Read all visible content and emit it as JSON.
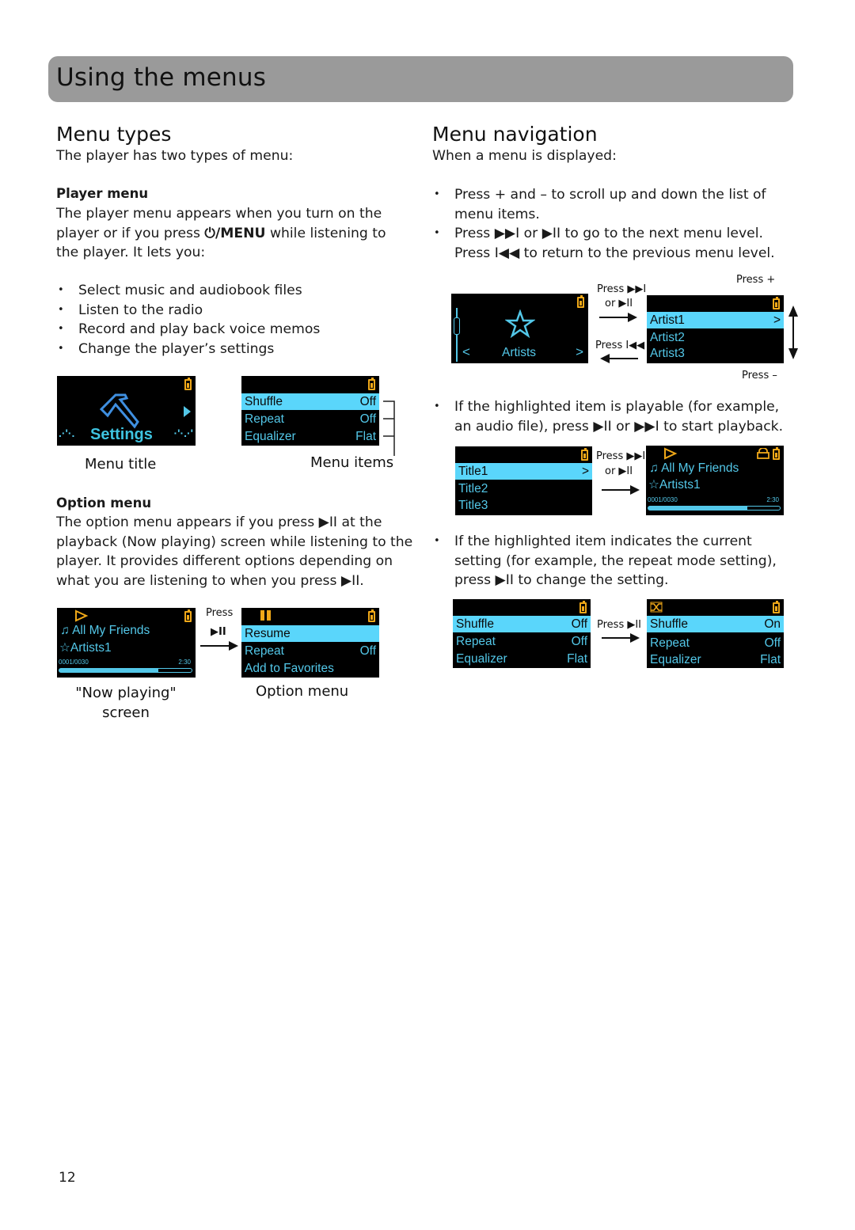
{
  "page": {
    "title": "Using the menus",
    "page_number": "12"
  },
  "menu_types": {
    "heading": "Menu types",
    "intro": "The player has two types of menu:",
    "player_menu": {
      "heading": "Player menu",
      "text_before": "The player menu appears when you turn on the player or if you press ",
      "button": "⏻/MENU",
      "text_after": " while listening to the player. It lets you:",
      "bullets": [
        "Select music and audiobook files",
        "Listen to the radio",
        "Record and play back voice memos",
        "Change the player’s settings"
      ],
      "screen_title": {
        "label": "Settings",
        "caption": "Menu title"
      },
      "screen_items": {
        "rows": [
          {
            "label": "Shuffle",
            "value": "Off",
            "selected": true
          },
          {
            "label": "Repeat",
            "value": "Off",
            "selected": false
          },
          {
            "label": "Equalizer",
            "value": "Flat",
            "selected": false
          }
        ],
        "caption": "Menu items"
      }
    },
    "option_menu": {
      "heading": "Option menu",
      "text": "The option menu appears if you press ▶II at the playback (Now playing) screen while listening to the player. It provides different options depending on what you are listening to when you press ▶II.",
      "now_playing": {
        "song": "All My Friends",
        "artist": "Artists1",
        "track": "0001/0030",
        "time": "2:30",
        "progress": 0.75,
        "caption_line1": "\"Now playing\"",
        "caption_line2": "screen"
      },
      "press_label": "Press",
      "press_button": "▶II",
      "option_screen": {
        "rows": [
          {
            "label": "Resume",
            "value": "",
            "selected": true
          },
          {
            "label": "Repeat",
            "value": "Off",
            "selected": false
          },
          {
            "label": "Add to Favorites",
            "value": "",
            "selected": false
          }
        ],
        "caption": "Option menu"
      }
    }
  },
  "menu_navigation": {
    "heading": "Menu navigation",
    "intro": "When a menu is displayed:",
    "bullets": [
      "Press + and – to scroll up and down the list of menu items.",
      "Press ▶▶I or ▶II to go to the next menu level. Press I◀◀ to return to the previous menu level."
    ],
    "diagram1": {
      "category_label": "Artists",
      "press_next_line1": "Press ▶▶I",
      "press_next_line2": "or ▶II",
      "press_back": "Press I◀◀",
      "press_plus": "Press +",
      "press_minus": "Press –",
      "rows": [
        {
          "label": "Artist1",
          "selected": true
        },
        {
          "label": "Artist2",
          "selected": false
        },
        {
          "label": "Artist3",
          "selected": false
        }
      ]
    },
    "bullet_playable": "If the highlighted item is playable (for example, an audio file), press ▶II or ▶▶I to start playback.",
    "diagram2": {
      "rows": [
        {
          "label": "Title1",
          "selected": true
        },
        {
          "label": "Title2",
          "selected": false
        },
        {
          "label": "Title3",
          "selected": false
        }
      ],
      "press_line1": "Press ▶▶I",
      "press_line2": "or ▶II",
      "now_playing": {
        "song": "All My Friends",
        "artist": "Artists1",
        "track": "0001/0030",
        "time": "2:30",
        "progress": 0.75
      }
    },
    "bullet_setting": "If the highlighted item indicates the current setting (for example, the repeat mode setting), press ▶II to change the setting.",
    "diagram3": {
      "before": [
        {
          "label": "Shuffle",
          "value": "Off",
          "selected": true
        },
        {
          "label": "Repeat",
          "value": "Off",
          "selected": false
        },
        {
          "label": "Equalizer",
          "value": "Flat",
          "selected": false
        }
      ],
      "press": "Press ▶II",
      "after": [
        {
          "label": "Shuffle",
          "value": "On",
          "selected": true
        },
        {
          "label": "Repeat",
          "value": "Off",
          "selected": false
        },
        {
          "label": "Equalizer",
          "value": "Flat",
          "selected": false
        }
      ]
    }
  }
}
